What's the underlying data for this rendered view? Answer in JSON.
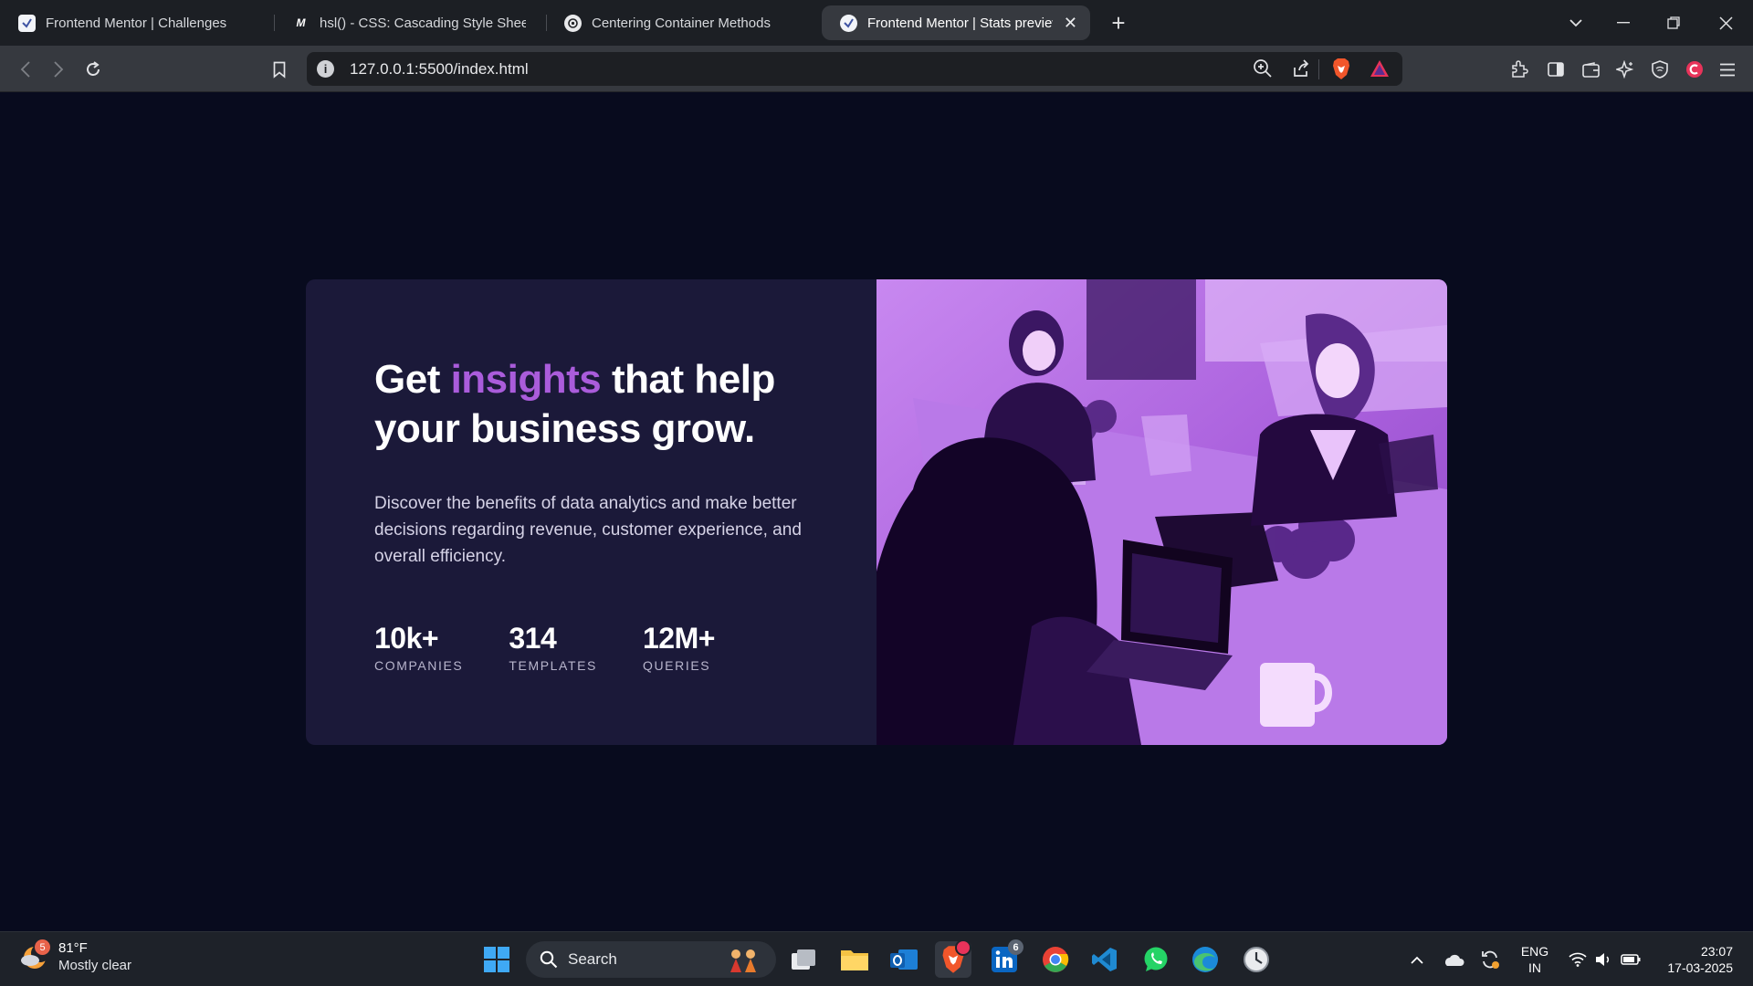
{
  "browser": {
    "tabs": [
      {
        "title": "Frontend Mentor | Challenges",
        "favicon": "frontend-mentor-icon",
        "active": false
      },
      {
        "title": "hsl() - CSS: Cascading Style Sheets |",
        "favicon": "mdn-icon",
        "favicon_text": "M",
        "active": false
      },
      {
        "title": "Centering Container Methods",
        "favicon": "chatgpt-icon",
        "active": false
      },
      {
        "title": "Frontend Mentor | Stats preview",
        "favicon": "frontend-mentor-icon",
        "active": true
      }
    ],
    "url": "127.0.0.1:5500/index.html"
  },
  "page": {
    "headline_part1": "Get ",
    "headline_accent": "insights",
    "headline_part2": " that help your business grow.",
    "description": "Discover the benefits of data analytics and make better decisions regarding revenue, customer experience, and overall efficiency.",
    "stats": [
      {
        "value": "10k+",
        "label": "COMPANIES"
      },
      {
        "value": "314",
        "label": "TEMPLATES"
      },
      {
        "value": "12M+",
        "label": "QUERIES"
      }
    ],
    "colors": {
      "background": "#080b1e",
      "card": "#1b1939",
      "accent": "#aa5cdb"
    }
  },
  "taskbar": {
    "weather_temp": "81°F",
    "weather_desc": "Mostly clear",
    "weather_badge": "5",
    "search_label": "Search",
    "linkedin_badge": "6",
    "lang_top": "ENG",
    "lang_bottom": "IN",
    "time": "23:07",
    "date": "17-03-2025"
  }
}
